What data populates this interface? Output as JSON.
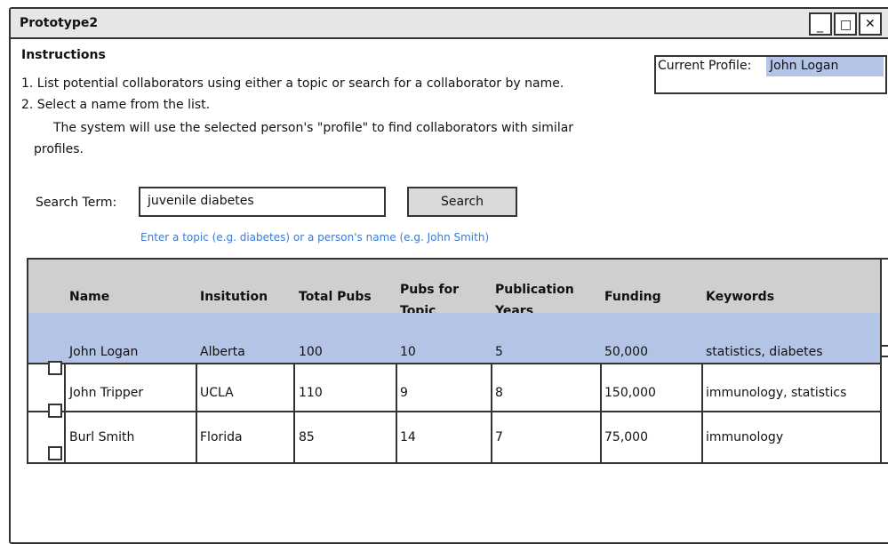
{
  "window": {
    "title": "Prototype2"
  },
  "instructions": {
    "title": "Instructions",
    "line1": "1.  List potential collaborators using either a topic or search for a collaborator by name.",
    "line2": "2.  Select a name from the list.",
    "line3": "The system will use the selected person's \"profile\" to find collaborators with similar",
    "line4": "profiles."
  },
  "profile": {
    "label": "Current Profile:",
    "value": "John Logan"
  },
  "search": {
    "label": "Search Term:",
    "value": "juvenile diabetes",
    "button": "Search",
    "hint": "Enter a topic (e.g. diabetes) or a person's name (e.g. John Smith)"
  },
  "table": {
    "headers": [
      "Name",
      "Insitution",
      "Total Pubs",
      "Pubs for Topic",
      "Publication Years",
      "Funding",
      "Keywords"
    ],
    "rows": [
      [
        "John Logan",
        "Alberta",
        "100",
        "10",
        "5",
        "50,000",
        "statistics, diabetes"
      ],
      [
        "John Tripper",
        "UCLA",
        "110",
        "9",
        "8",
        "150,000",
        "immunology, statistics"
      ],
      [
        "Burl Smith",
        "Florida",
        "85",
        "14",
        "7",
        "75,000",
        "immunology"
      ]
    ]
  }
}
